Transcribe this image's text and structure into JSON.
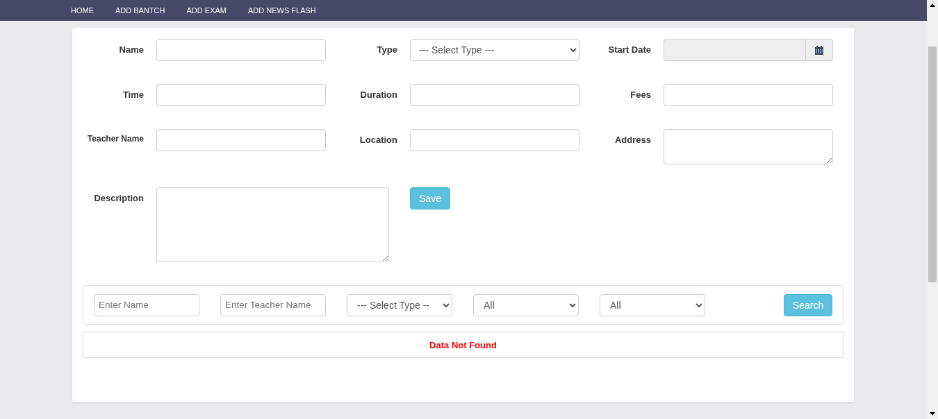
{
  "nav": [
    {
      "label": "HOME"
    },
    {
      "label": "ADD BANTCH"
    },
    {
      "label": "ADD EXAM"
    },
    {
      "label": "ADD NEWS FLASH"
    }
  ],
  "form": {
    "rows": [
      [
        {
          "label": "Name",
          "kind": "text"
        },
        {
          "label": "Type",
          "kind": "select",
          "value": "--- Select Type ---"
        },
        {
          "label": "Start Date",
          "kind": "date"
        }
      ],
      [
        {
          "label": "Time",
          "kind": "text"
        },
        {
          "label": "Duration",
          "kind": "text"
        },
        {
          "label": "Fees",
          "kind": "text"
        }
      ],
      [
        {
          "label": "Teacher Name",
          "kind": "text",
          "small": true
        },
        {
          "label": "Location",
          "kind": "text"
        },
        {
          "label": "Address",
          "kind": "textarea"
        }
      ],
      [
        {
          "label": "Description",
          "kind": "bigtextarea"
        }
      ]
    ],
    "save_button": "Save"
  },
  "search": {
    "filters": [
      {
        "kind": "text",
        "placeholder": "Enter Name"
      },
      {
        "kind": "text",
        "placeholder": "Enter Teacher Name"
      },
      {
        "kind": "select",
        "value": "--- Select Type --"
      },
      {
        "kind": "select",
        "value": "All"
      },
      {
        "kind": "select",
        "value": "All"
      }
    ],
    "button": "Search"
  },
  "message": "Data Not Found"
}
